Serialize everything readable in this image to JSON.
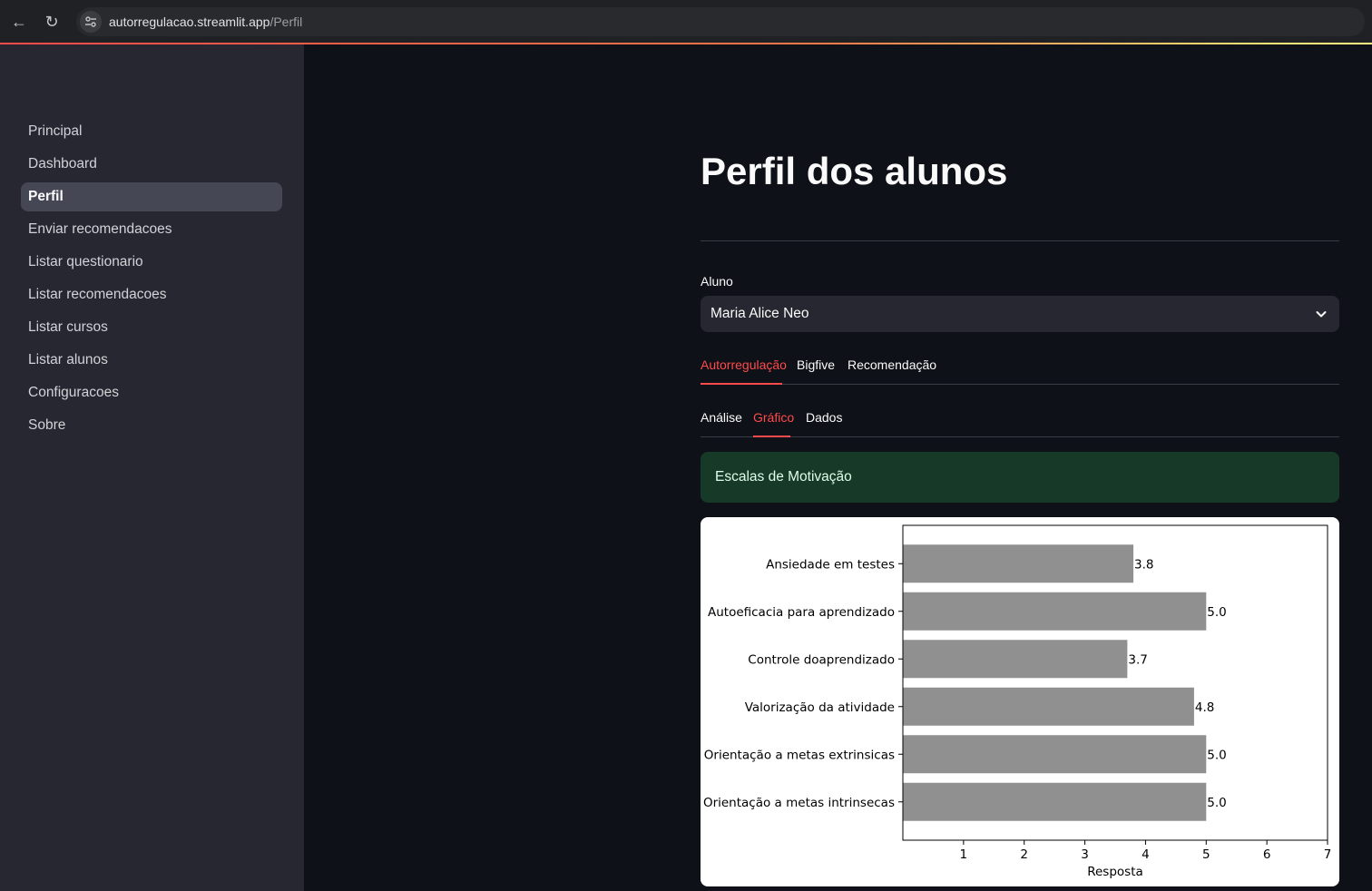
{
  "browser": {
    "url_host": "autorregulacao.streamlit.app",
    "url_path": "/Perfil"
  },
  "sidebar": {
    "items": [
      {
        "label": "Principal",
        "active": false
      },
      {
        "label": "Dashboard",
        "active": false
      },
      {
        "label": "Perfil",
        "active": true
      },
      {
        "label": "Enviar recomendacoes",
        "active": false
      },
      {
        "label": "Listar questionario",
        "active": false
      },
      {
        "label": "Listar recomendacoes",
        "active": false
      },
      {
        "label": "Listar cursos",
        "active": false
      },
      {
        "label": "Listar alunos",
        "active": false
      },
      {
        "label": "Configuracoes",
        "active": false
      },
      {
        "label": "Sobre",
        "active": false
      }
    ]
  },
  "main": {
    "title": "Perfil dos alunos",
    "student_select": {
      "label": "Aluno",
      "value": "Maria Alice Neo"
    },
    "tabs": [
      {
        "label": "Autorregulação",
        "active": true
      },
      {
        "label": "Bigfive",
        "active": false
      },
      {
        "label": "Recomendação",
        "active": false
      }
    ],
    "subtabs": [
      {
        "label": "Análise",
        "active": false
      },
      {
        "label": "Gráfico",
        "active": true
      },
      {
        "label": "Dados",
        "active": false
      }
    ],
    "alert_text": "Escalas de Motivação"
  },
  "colors": {
    "accent": "#ff4b4b",
    "bar": "#909090",
    "success_bg": "#173928"
  },
  "chart_data": {
    "type": "bar",
    "orientation": "horizontal",
    "categories": [
      "Ansiedade em testes",
      "Autoeficacia para aprendizado",
      "Controle doaprendizado",
      "Valorização da atividade",
      "Orientação a metas extrinsicas",
      "Orientação a metas intrinsecas"
    ],
    "values": [
      3.8,
      5.0,
      3.7,
      4.8,
      5.0,
      5.0
    ],
    "data_labels": [
      "3.8",
      "5.0",
      "3.7",
      "4.8",
      "5.0",
      "5.0"
    ],
    "xlabel": "Resposta",
    "xlim": [
      0,
      7
    ],
    "xticks": [
      1,
      2,
      3,
      4,
      5,
      6,
      7
    ],
    "grid": false
  }
}
